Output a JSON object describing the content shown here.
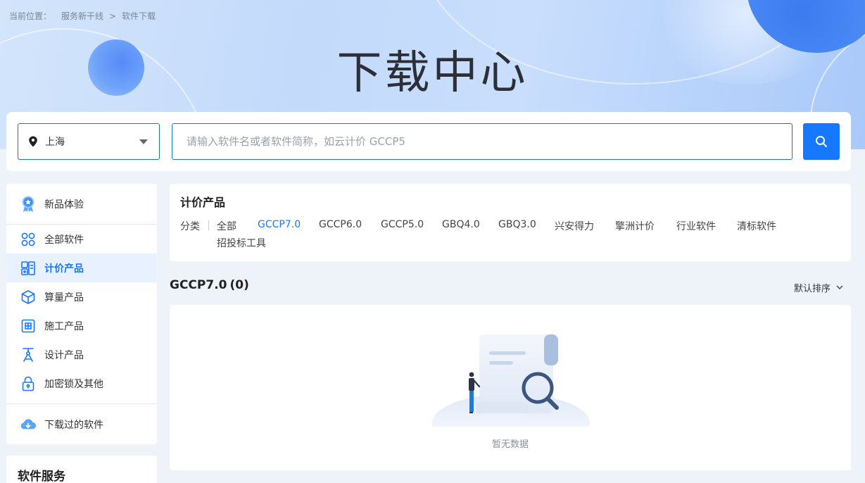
{
  "breadcrumb": {
    "label": "当前位置：",
    "items": [
      "服务新干线",
      "软件下载"
    ],
    "separator": ">"
  },
  "hero": {
    "title": "下载中心"
  },
  "search": {
    "city": "上海",
    "placeholder": "请输入软件名或者软件简称，如云计价 GCCP5"
  },
  "sidebar": {
    "top_item": {
      "label": "新品体验",
      "icon": "award-badge-icon"
    },
    "items": [
      {
        "label": "全部软件",
        "icon": "grid-circles-icon"
      },
      {
        "label": "计价产品",
        "icon": "calculator-grid-icon",
        "active": true
      },
      {
        "label": "算量产品",
        "icon": "cube-icon"
      },
      {
        "label": "施工产品",
        "icon": "construction-board-icon"
      },
      {
        "label": "设计产品",
        "icon": "compass-tool-icon"
      },
      {
        "label": "加密锁及其他",
        "icon": "lock-icon"
      }
    ],
    "bottom_item": {
      "label": "下载过的软件",
      "icon": "cloud-download-icon"
    }
  },
  "services": {
    "title": "软件服务"
  },
  "filter": {
    "title": "计价产品",
    "label": "分类",
    "options": [
      "全部",
      "GCCP7.0",
      "GCCP6.0",
      "GCCP5.0",
      "GBQ4.0",
      "GBQ3.0",
      "兴安得力",
      "擎洲计价",
      "行业软件",
      "清标软件",
      "招投标工具"
    ],
    "active": "GCCP7.0"
  },
  "results": {
    "title": "GCCP7.0",
    "count": "(0)",
    "sort_label": "默认排序",
    "empty_text": "暂无数据"
  },
  "colors": {
    "accent": "#1677ff",
    "border_blue": "#1a6fd8"
  }
}
